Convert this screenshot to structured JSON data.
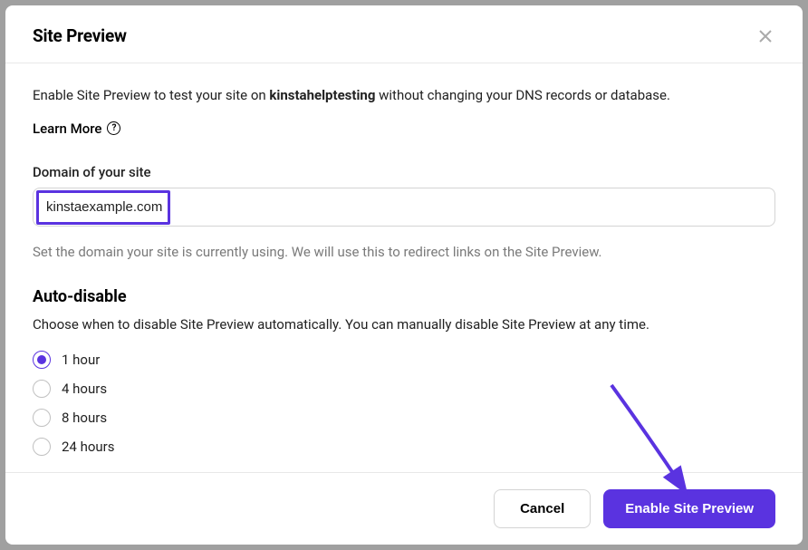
{
  "modal": {
    "title": "Site Preview",
    "intro_prefix": "Enable Site Preview to test your site on ",
    "intro_bold": "kinstahelptesting",
    "intro_suffix": " without changing your DNS records or database.",
    "learn_more": "Learn More",
    "domain": {
      "label": "Domain of your site",
      "value": "kinstaexample.com",
      "helper": "Set the domain your site is currently using. We will use this to redirect links on the Site Preview."
    },
    "auto_disable": {
      "heading": "Auto-disable",
      "description": "Choose when to disable Site Preview automatically. You can manually disable Site Preview at any time.",
      "selected_index": 0,
      "options": [
        "1 hour",
        "4 hours",
        "8 hours",
        "24 hours"
      ]
    },
    "footer": {
      "cancel": "Cancel",
      "submit": "Enable Site Preview"
    }
  },
  "colors": {
    "accent": "#5a33e0"
  }
}
